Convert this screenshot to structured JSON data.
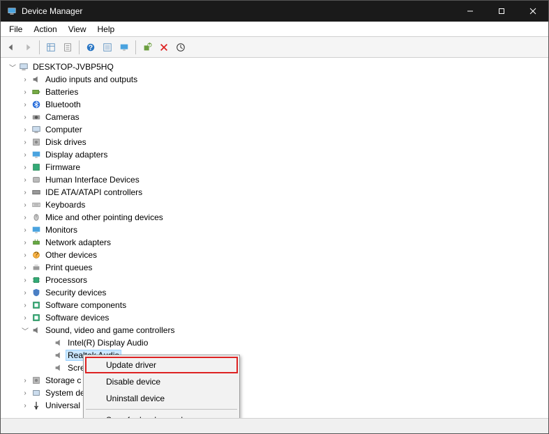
{
  "window": {
    "title": "Device Manager"
  },
  "menu": {
    "file": "File",
    "action": "Action",
    "view": "View",
    "help": "Help"
  },
  "toolbar_icons": {
    "back": "back-arrow-icon",
    "forward": "forward-arrow-icon",
    "show_tree": "show-hidden-icon",
    "properties": "properties-icon",
    "help": "help-icon",
    "scan": "scan-icon",
    "monitor": "monitor-icon",
    "add": "add-legacy-icon",
    "remove": "uninstall-icon",
    "update": "update-driver-icon"
  },
  "tree": {
    "root": "DESKTOP-JVBP5HQ",
    "categories": [
      {
        "label": "Audio inputs and outputs",
        "icon": "speaker-icon"
      },
      {
        "label": "Batteries",
        "icon": "battery-icon"
      },
      {
        "label": "Bluetooth",
        "icon": "bluetooth-icon"
      },
      {
        "label": "Cameras",
        "icon": "camera-icon"
      },
      {
        "label": "Computer",
        "icon": "computer-icon"
      },
      {
        "label": "Disk drives",
        "icon": "disk-icon"
      },
      {
        "label": "Display adapters",
        "icon": "display-icon"
      },
      {
        "label": "Firmware",
        "icon": "firmware-icon"
      },
      {
        "label": "Human Interface Devices",
        "icon": "hid-icon"
      },
      {
        "label": "IDE ATA/ATAPI controllers",
        "icon": "ide-icon"
      },
      {
        "label": "Keyboards",
        "icon": "keyboard-icon"
      },
      {
        "label": "Mice and other pointing devices",
        "icon": "mouse-icon"
      },
      {
        "label": "Monitors",
        "icon": "monitor-icon"
      },
      {
        "label": "Network adapters",
        "icon": "network-icon"
      },
      {
        "label": "Other devices",
        "icon": "other-icon"
      },
      {
        "label": "Print queues",
        "icon": "printer-icon"
      },
      {
        "label": "Processors",
        "icon": "cpu-icon"
      },
      {
        "label": "Security devices",
        "icon": "security-icon"
      },
      {
        "label": "Software components",
        "icon": "software-icon"
      },
      {
        "label": "Software devices",
        "icon": "software-icon"
      }
    ],
    "expanded": {
      "label": "Sound, video and game controllers",
      "icon": "speaker-icon",
      "children": [
        {
          "label": "Intel(R) Display Audio",
          "icon": "speaker-small-icon"
        },
        {
          "label": "Realtek Audio",
          "icon": "speaker-small-icon",
          "selected": true
        },
        {
          "label": "Screa",
          "icon": "speaker-small-icon",
          "truncated": true
        }
      ]
    },
    "after": [
      {
        "label": "Storage c",
        "icon": "storage-icon",
        "truncated": true
      },
      {
        "label": "System de",
        "icon": "system-icon",
        "truncated": true
      },
      {
        "label": "Universal",
        "icon": "usb-icon",
        "truncated": true
      }
    ]
  },
  "context_menu": {
    "items": [
      {
        "label": "Update driver",
        "highlight": true
      },
      {
        "label": "Disable device"
      },
      {
        "label": "Uninstall device"
      }
    ],
    "sep_then": {
      "label": "Scan for hardware changes"
    }
  }
}
